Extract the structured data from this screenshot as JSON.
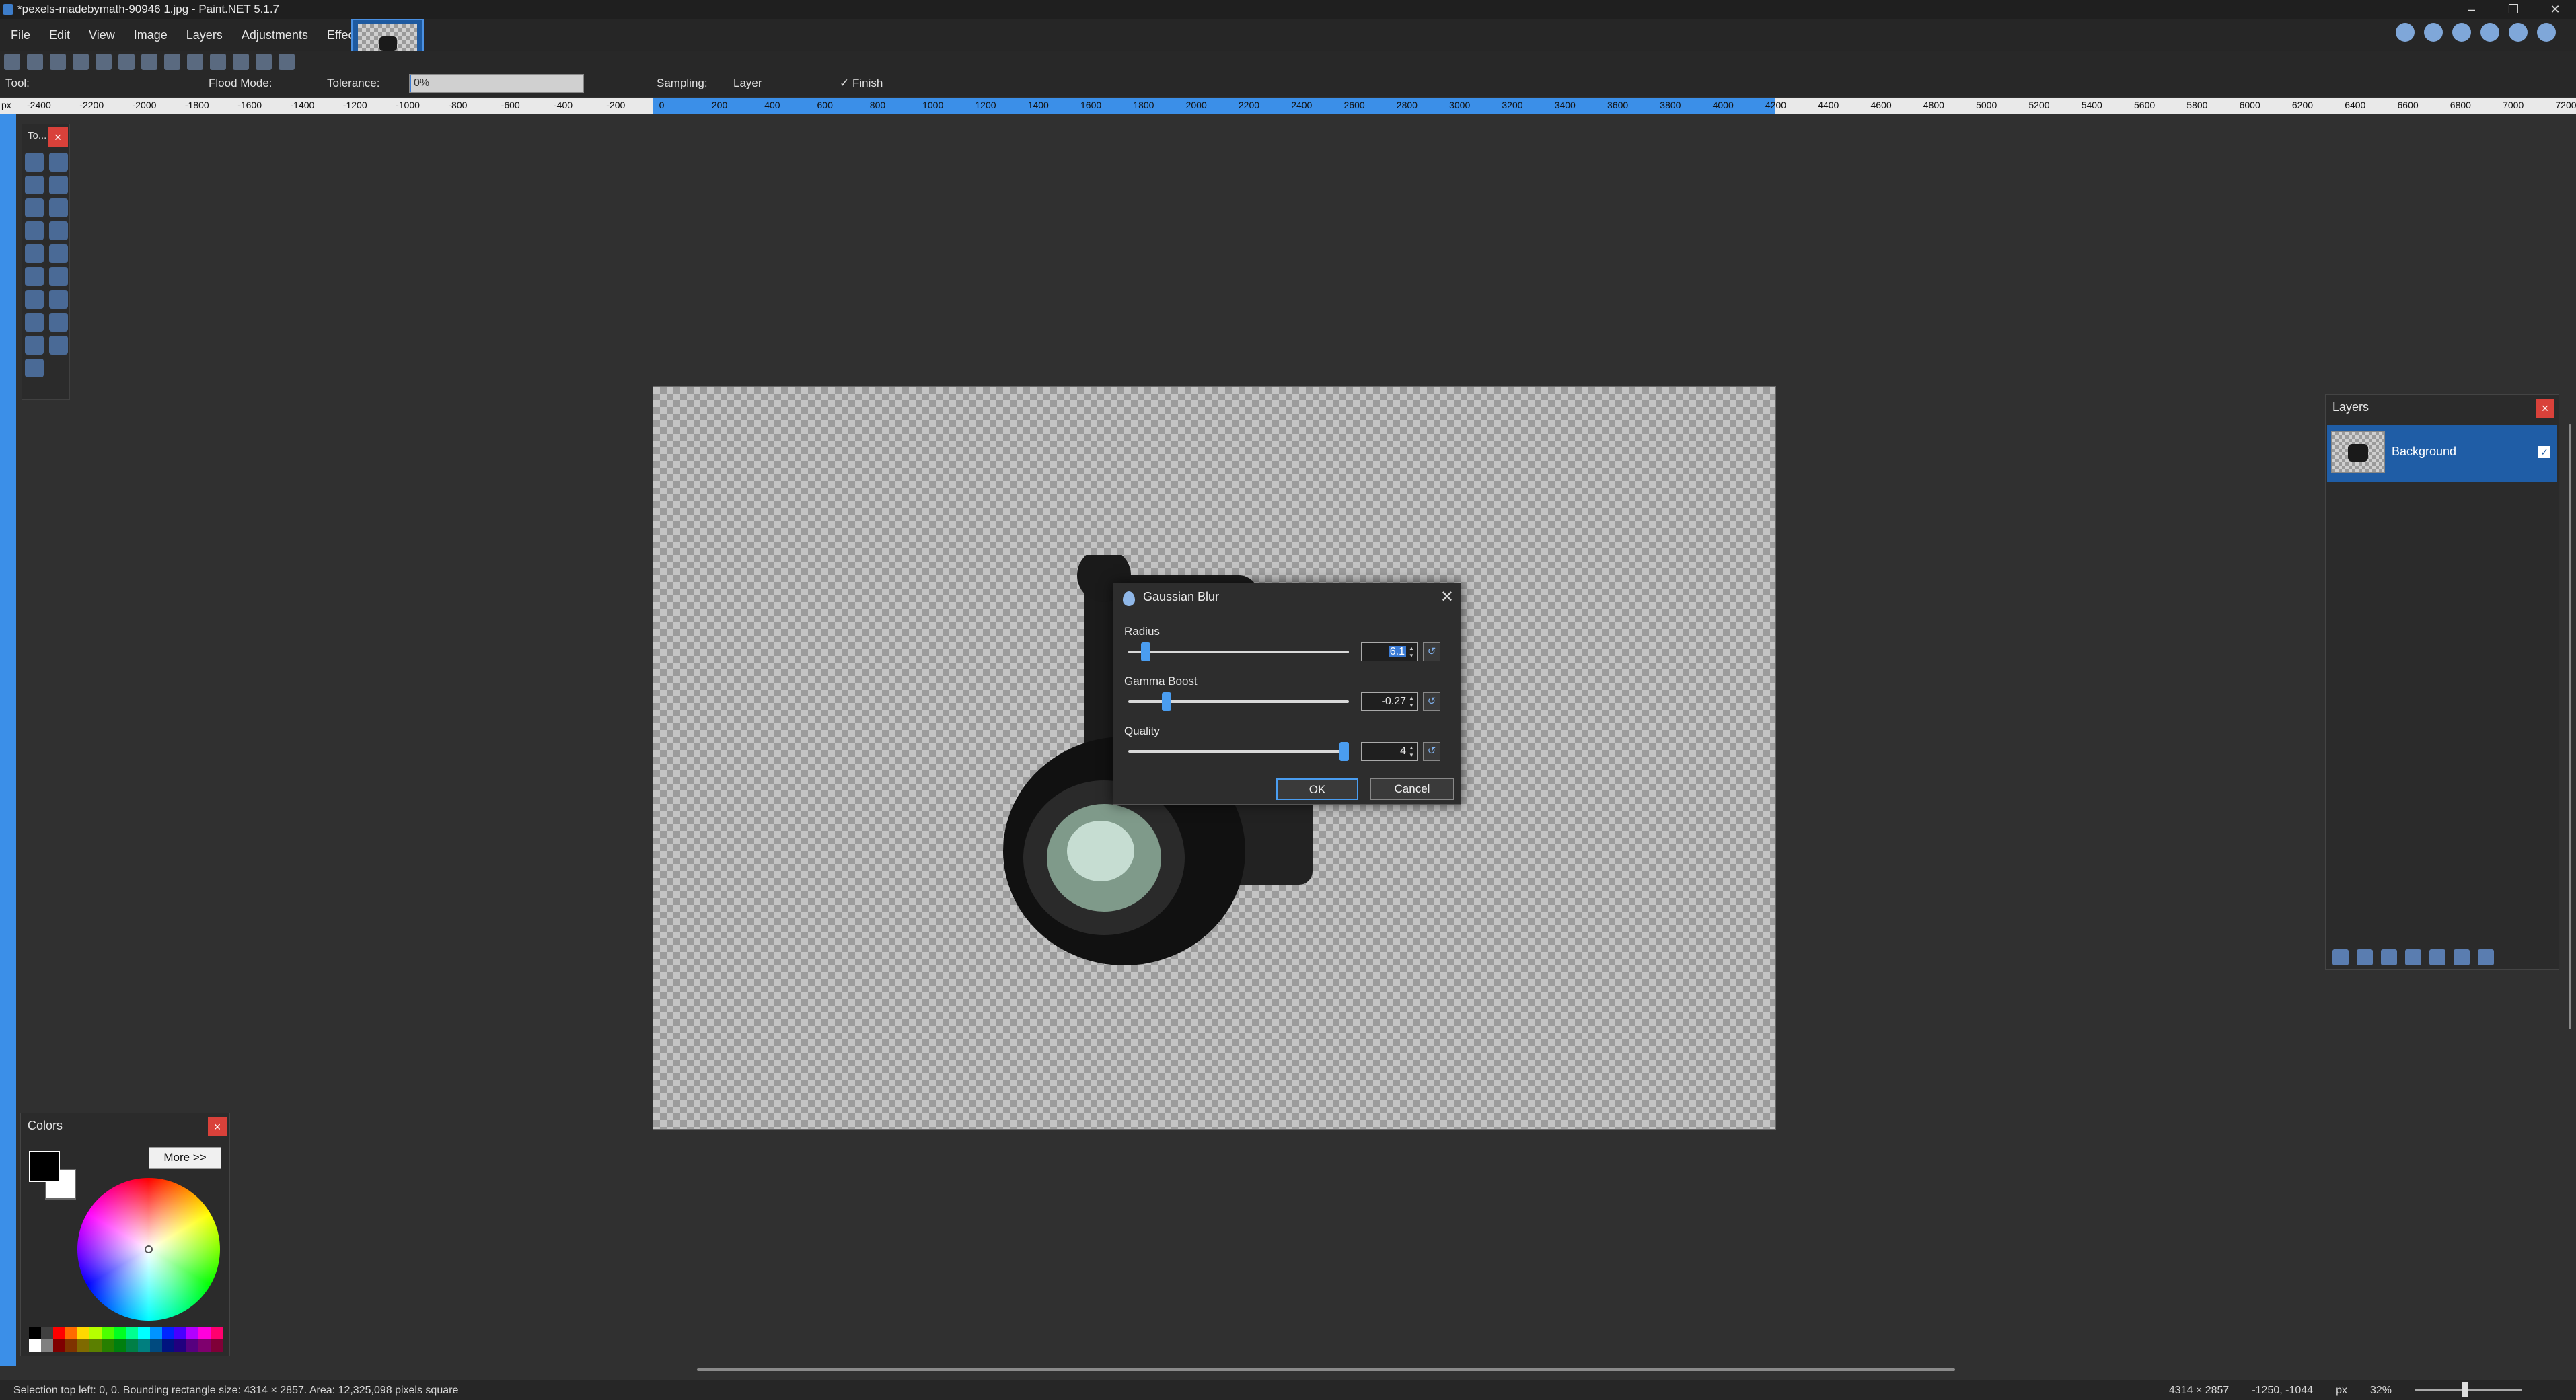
{
  "window": {
    "title": "*pexels-madebymath-90946 1.jpg - Paint.NET 5.1.7",
    "controls": [
      "–",
      "❐",
      "✕"
    ]
  },
  "menu": [
    "File",
    "Edit",
    "View",
    "Image",
    "Layers",
    "Adjustments",
    "Effects"
  ],
  "toolbar": {
    "tool_label": "Tool:",
    "flood_mode_label": "Flood Mode:",
    "tolerance_label": "Tolerance:",
    "tolerance_value": "0%",
    "tolerance_fraction": 0.0,
    "sampling_label": "Sampling:",
    "sampling_value": "Layer",
    "finish_label": "✓ Finish"
  },
  "ruler": {
    "unit": "px",
    "ticks": [
      "-2400",
      "-2200",
      "-2000",
      "-1800",
      "-1600",
      "-1400",
      "-1200",
      "-1000",
      "-800",
      "-600",
      "-400",
      "-200",
      "0",
      "200",
      "400",
      "600",
      "800",
      "1000",
      "1200",
      "1400",
      "1600",
      "1800",
      "2000",
      "2200",
      "2400",
      "2600",
      "2800",
      "3000",
      "3200",
      "3400",
      "3600",
      "3800",
      "4000",
      "4200",
      "4400",
      "4600",
      "4800",
      "5000",
      "5200",
      "5400",
      "5600",
      "5800",
      "6000",
      "6200",
      "6400",
      "6600",
      "6800",
      "7000",
      "7200"
    ]
  },
  "tools_panel": {
    "title": "To...",
    "close": "×"
  },
  "dialog": {
    "title": "Gaussian Blur",
    "close": "✕",
    "params": [
      {
        "label": "Radius",
        "value": "6.1",
        "position": 0.06,
        "selected": true
      },
      {
        "label": "Gamma Boost",
        "value": "-0.27",
        "position": 0.16,
        "selected": false
      },
      {
        "label": "Quality",
        "value": "4",
        "position": 1.0,
        "selected": false
      }
    ],
    "ok": "OK",
    "cancel": "Cancel"
  },
  "layers_panel": {
    "title": "Layers",
    "close": "×",
    "layers": [
      {
        "name": "Background",
        "visible": true
      }
    ]
  },
  "colors_panel": {
    "title": "Colors",
    "close": "×",
    "more": "More >>",
    "primary": "#000000",
    "secondary": "#ffffff",
    "palette": [
      "#000000",
      "#404040",
      "#ff0000",
      "#ff6a00",
      "#ffd800",
      "#b6ff00",
      "#4cff00",
      "#00ff21",
      "#00ff90",
      "#00ffff",
      "#0094ff",
      "#0026ff",
      "#4800ff",
      "#b200ff",
      "#ff00dc",
      "#ff006e",
      "#ffffff",
      "#808080",
      "#7f0000",
      "#7f3300",
      "#7f6a00",
      "#5b7f00",
      "#267f00",
      "#007f0e",
      "#007f46",
      "#007f7f",
      "#004a7f",
      "#00137f",
      "#21007f",
      "#57007f",
      "#7f006e",
      "#7f0037"
    ]
  },
  "statusbar": {
    "selection_info": "Selection top left: 0, 0. Bounding rectangle size: 4314 × 2857. Area: 12,325,098 pixels square",
    "image_size": "4314 × 2857",
    "cursor_pos": "-1250, -1044",
    "unit": "px",
    "zoom": "32%"
  }
}
